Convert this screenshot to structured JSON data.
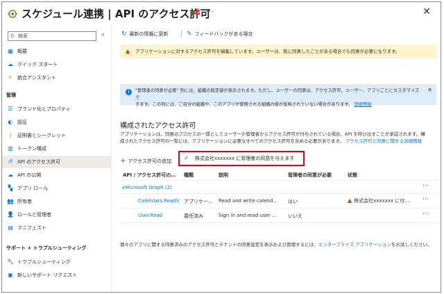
{
  "header": {
    "title": "スケジュール連携 | API のアクセス許可",
    "pin_icon": "pin-icon",
    "more_label": "···",
    "close_label": "✕"
  },
  "sidebar": {
    "search_placeholder": "検索",
    "collapse_label": "«",
    "items_top": [
      {
        "label": "概要",
        "icon": "grid-icon"
      },
      {
        "label": "クイック スタート",
        "icon": "cloud-icon"
      },
      {
        "label": "統合アシスタント",
        "icon": "rocket-icon"
      }
    ],
    "manage_section": "管理",
    "manage_items": [
      {
        "label": "ブランド化とプロパティ",
        "icon": "brand-icon"
      },
      {
        "label": "認証",
        "icon": "auth-icon"
      },
      {
        "label": "証明書とシークレット",
        "icon": "key-icon"
      },
      {
        "label": "トークン構成",
        "icon": "token-icon"
      },
      {
        "label": "API のアクセス許可",
        "icon": "api-icon"
      },
      {
        "label": "API の公開",
        "icon": "cloud-api-icon"
      },
      {
        "label": "アプリ ロール",
        "icon": "app-role-icon"
      },
      {
        "label": "所有者",
        "icon": "owner-icon"
      },
      {
        "label": "ロールと管理者",
        "icon": "role-admin-icon"
      },
      {
        "label": "マニフェスト",
        "icon": "manifest-icon"
      }
    ],
    "support_section": "サポート + トラブルシューティング",
    "support_items": [
      {
        "label": "トラブルシューティング",
        "icon": "wrench-icon"
      },
      {
        "label": "新しいサポート リクエスト",
        "icon": "support-icon"
      }
    ]
  },
  "toolbar": {
    "refresh_label": "最新の情報に更新",
    "feedback_label": "フィードバックがある場合"
  },
  "warning_banner": "アプリケーションに対するアクセス許可を編集しています。ユーザーは、既に同意したことがある場合でも同意が必要になります。",
  "info_banner": {
    "line1": "\"管理者の同意が必要\" 列には、組織の既定値が表示されます。ただし、ユーザーの同意は、アクセス許可、ユーザー、アプリごとにカスタマイズで",
    "line2": "きます。この列には、ご自分の組織や、このアプリが使用される組織の値が反映されていない場合があります。",
    "link": "詳細情報",
    "close_label": "✕"
  },
  "permissions": {
    "title": "構成されたアクセス許可",
    "desc1": "アプリケーションは、同意のプロセスの一環としてユーザーか管理者からアクセス許可が付与されている場合、API を呼び出すことが承認されます。構",
    "desc2": "成されたアクセス許可の一覧には、アプリケーションに必要なすべてのアクセス許可を含める必要があります。",
    "desc_link": "アクセス許可と同意に関する詳細情報",
    "add_label": "アクセス許可の追加",
    "grant_label": "株式会社xxxxxxx に管理者の同意を与えます",
    "columns": [
      "API / アクセス許可の…",
      "種類",
      "説明",
      "管理者の同意が必要",
      "状態"
    ],
    "group_label": "Microsoft Graph (2)",
    "rows": [
      {
        "api": "Calendars.ReadV",
        "type": "アプリケー…",
        "desc": "Read and write calend…",
        "admin": "はい",
        "status": "株式会社xxxxxxx に付…"
      },
      {
        "api": "User.Read",
        "type": "委任済み",
        "desc": "Sign in and read user …",
        "admin": "いいえ",
        "status": ""
      }
    ]
  },
  "footer": {
    "text": "個々のアプリに関する同意済みのアクセス許可とテナントの同意設定を表示および管理するには、",
    "link": "エンタープライズ アプリケーション",
    "suffix": "をお試しください。"
  }
}
